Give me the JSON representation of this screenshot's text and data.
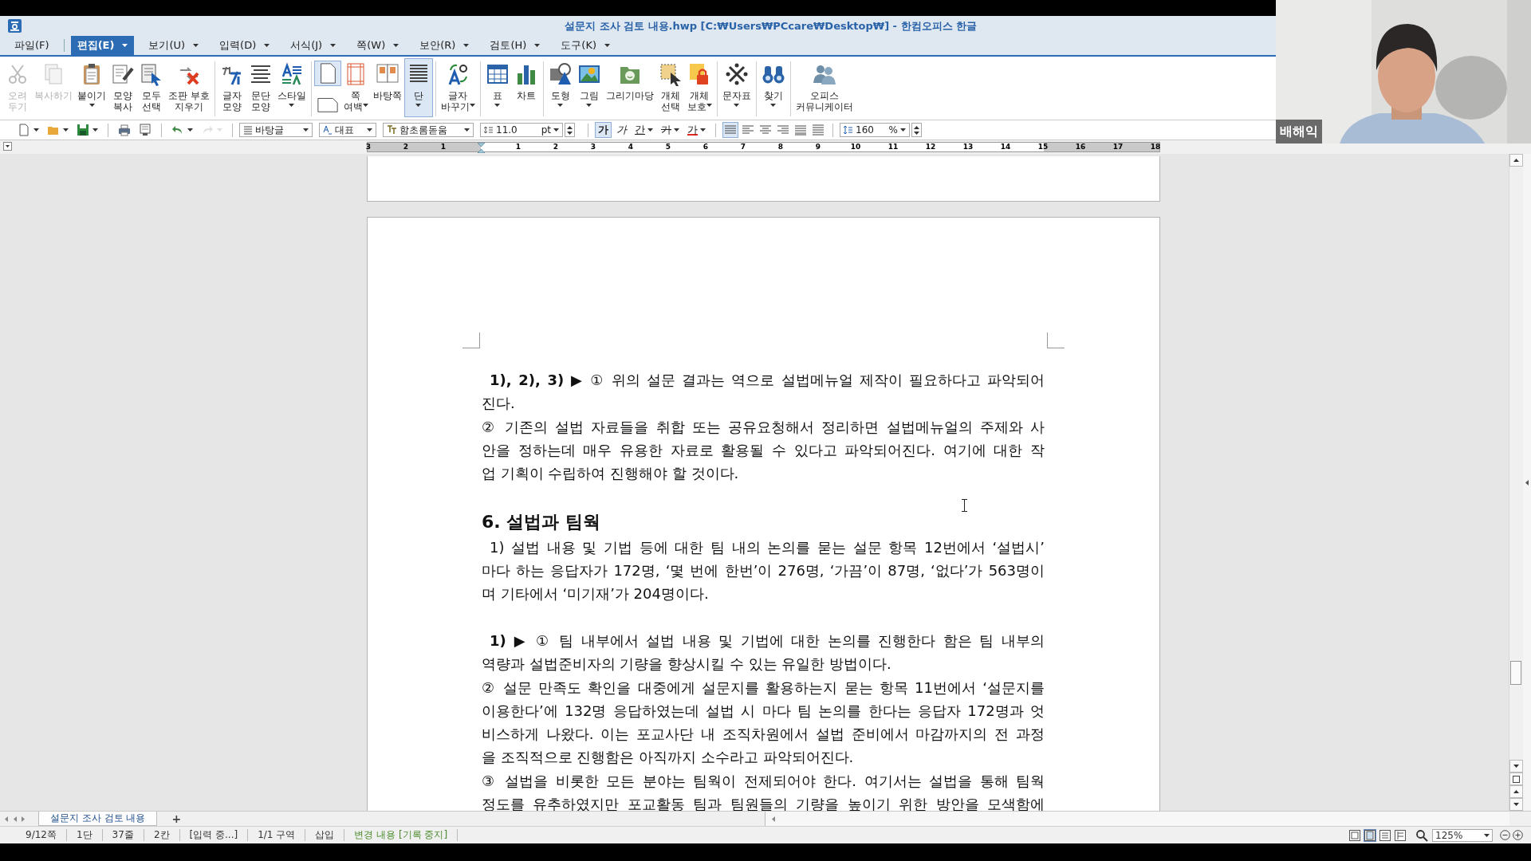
{
  "window": {
    "title": "설문지 조사 검토 내용.hwp [C:₩Users₩PCcare₩Desktop₩] - 한컴오피스 한글"
  },
  "menu": [
    {
      "label": "파일(F)",
      "selected": false,
      "dropdown": false
    },
    {
      "label": "편집(E)",
      "selected": true,
      "dropdown": true
    },
    {
      "label": "보기(U)",
      "selected": false,
      "dropdown": true
    },
    {
      "label": "입력(D)",
      "selected": false,
      "dropdown": true
    },
    {
      "label": "서식(J)",
      "selected": false,
      "dropdown": true
    },
    {
      "label": "쪽(W)",
      "selected": false,
      "dropdown": true
    },
    {
      "label": "보안(R)",
      "selected": false,
      "dropdown": true
    },
    {
      "label": "검토(H)",
      "selected": false,
      "dropdown": true
    },
    {
      "label": "도구(K)",
      "selected": false,
      "dropdown": true
    }
  ],
  "toolbar": [
    {
      "kind": "button",
      "label": "오려\n두기",
      "disabled": true,
      "pressed": false
    },
    {
      "kind": "button",
      "label": "복사하기",
      "disabled": true,
      "pressed": false
    },
    {
      "kind": "button",
      "label": "붙이기",
      "disabled": false,
      "pressed": false,
      "dropdown": true,
      "inline_caret": false
    },
    {
      "kind": "button",
      "label": "모양\n복사",
      "disabled": false,
      "pressed": false
    },
    {
      "kind": "button",
      "label": "모두\n선택",
      "disabled": false,
      "pressed": false
    },
    {
      "kind": "button",
      "label": "조판 부호\n지우기",
      "disabled": false,
      "pressed": false
    },
    {
      "kind": "separator"
    },
    {
      "kind": "button",
      "label": "글자\n모양",
      "disabled": false,
      "pressed": false
    },
    {
      "kind": "button",
      "label": "문단\n모양",
      "disabled": false,
      "pressed": false
    },
    {
      "kind": "button",
      "label": "스타일",
      "disabled": false,
      "pressed": false,
      "dropdown": true,
      "inline_caret": false
    },
    {
      "kind": "separator"
    },
    {
      "kind": "stack",
      "items": [
        {
          "pressed": true
        },
        {
          "pressed": false
        }
      ]
    },
    {
      "kind": "button",
      "label": "쪽\n여백",
      "disabled": false,
      "pressed": false,
      "dropdown": true,
      "inline_caret": true
    },
    {
      "kind": "button",
      "label": "바탕쪽",
      "disabled": false,
      "pressed": false
    },
    {
      "kind": "button",
      "label": "단",
      "disabled": false,
      "pressed": true,
      "dropdown": true,
      "inline_caret": false
    },
    {
      "kind": "separator"
    },
    {
      "kind": "button",
      "label": "글자\n바꾸기",
      "disabled": false,
      "pressed": false,
      "dropdown": true,
      "inline_caret": true
    },
    {
      "kind": "separator"
    },
    {
      "kind": "button",
      "label": "표",
      "disabled": false,
      "pressed": false,
      "dropdown": true,
      "inline_caret": false
    },
    {
      "kind": "button",
      "label": "차트",
      "disabled": false,
      "pressed": false
    },
    {
      "kind": "separator"
    },
    {
      "kind": "button",
      "label": "도형",
      "disabled": false,
      "pressed": false,
      "dropdown": true,
      "inline_caret": false
    },
    {
      "kind": "button",
      "label": "그림",
      "disabled": false,
      "pressed": false,
      "dropdown": true,
      "inline_caret": false
    },
    {
      "kind": "button",
      "label": "그리기마당",
      "disabled": false,
      "pressed": false
    },
    {
      "kind": "button",
      "label": "개체\n선택",
      "disabled": false,
      "pressed": false
    },
    {
      "kind": "button",
      "label": "개체\n보호",
      "disabled": false,
      "pressed": false,
      "dropdown": true,
      "inline_caret": true
    },
    {
      "kind": "separator"
    },
    {
      "kind": "button",
      "label": "문자표",
      "disabled": false,
      "pressed": false,
      "dropdown": true,
      "inline_caret": false
    },
    {
      "kind": "separator"
    },
    {
      "kind": "button",
      "label": "찾기",
      "disabled": false,
      "pressed": false,
      "dropdown": true,
      "inline_caret": false
    },
    {
      "kind": "separator"
    },
    {
      "kind": "button",
      "label": "오피스\n커뮤니케이터",
      "disabled": false,
      "pressed": false
    }
  ],
  "format_bar": {
    "tools": [
      {
        "kind": "new",
        "dropdown": true,
        "disabled": false
      },
      {
        "kind": "open",
        "dropdown": true,
        "disabled": false
      },
      {
        "kind": "save",
        "dropdown": true,
        "disabled": false
      },
      {
        "kind": "separator"
      },
      {
        "kind": "print",
        "dropdown": false,
        "disabled": false
      },
      {
        "kind": "preview",
        "dropdown": false,
        "disabled": false
      },
      {
        "kind": "separator"
      },
      {
        "kind": "undo",
        "dropdown": true,
        "disabled": false
      },
      {
        "kind": "redo",
        "dropdown": true,
        "disabled": true
      }
    ],
    "style": "바탕글",
    "language": "대표",
    "font": "함초롬돋움",
    "size": "11.0",
    "size_unit": "pt",
    "char_buttons": [
      {
        "kind": "bold",
        "label": "가",
        "pressed": true,
        "dropdown": false
      },
      {
        "kind": "italic",
        "label": "가",
        "pressed": false,
        "dropdown": false
      },
      {
        "kind": "underline",
        "label": "간",
        "pressed": false,
        "dropdown": true
      },
      {
        "kind": "strike",
        "label": "가",
        "pressed": false,
        "dropdown": true
      },
      {
        "kind": "color",
        "label": "가",
        "pressed": false,
        "dropdown": true
      }
    ],
    "align": [
      {
        "kind": "justify",
        "pressed": true
      },
      {
        "kind": "left",
        "pressed": false
      },
      {
        "kind": "center",
        "pressed": false
      },
      {
        "kind": "right",
        "pressed": false
      },
      {
        "kind": "distribute",
        "pressed": false
      },
      {
        "kind": "divide",
        "pressed": false
      }
    ],
    "line_spacing": "160",
    "line_spacing_unit": "%"
  },
  "ruler": {
    "left_numbers": [
      "3",
      "2",
      "1"
    ],
    "right_numbers": [
      "1",
      "2",
      "3",
      "4",
      "5",
      "6",
      "7",
      "8",
      "9",
      "10",
      "11",
      "12",
      "13",
      "14",
      "15",
      "16",
      "17",
      "18"
    ]
  },
  "document": {
    "paragraphs": [
      {
        "kind": "body",
        "indent": true,
        "continues": false,
        "lines": [
          "**1), 2), 3) ▶** ① 위의 설문 결과는 역으로 설법메뉴얼 제작이 필요하다고 파악되어",
          "진다."
        ]
      },
      {
        "kind": "body",
        "indent": false,
        "continues": false,
        "lines": [
          "② 기존의 설법 자료들을 취합 또는 공유요청해서 정리하면 설법메뉴얼의 주제와 사",
          "안을 정하는데 매우 유용한 자료로 활용될 수 있다고 파악되어진다. 여기에 대한 작",
          "업 기획이 수립하여 진행해야 할 것이다."
        ]
      },
      {
        "kind": "blank"
      },
      {
        "kind": "heading",
        "lines": [
          "6. 설법과 팀웍"
        ]
      },
      {
        "kind": "body",
        "indent": true,
        "continues": false,
        "lines": [
          "1) 설법 내용 및 기법 등에 대한 팀 내의 논의를 묻는 설문 항목 12번에서 ‘설법시’",
          "마다 하는 응답자가 172명, ‘몇 번에 한번’이 276명, ‘가끔’이 87명, ‘없다’가 563명이",
          "며 기타에서 ‘미기재’가 204명이다."
        ]
      },
      {
        "kind": "blank"
      },
      {
        "kind": "body",
        "indent": true,
        "continues": false,
        "lines": [
          "**1) ▶** ① 팀 내부에서 설법 내용 및 기법에 대한 논의를 진행한다 함은 팀 내부의",
          "역량과 설법준비자의 기량을 향상시킬 수 있는 유일한 방법이다."
        ]
      },
      {
        "kind": "body",
        "indent": false,
        "continues": false,
        "lines": [
          "② 설문 만족도 확인을 대중에게 설문지를 활용하는지 묻는 항목 11번에서 ‘설문지를",
          "이용한다’에 132명 응답하였는데 설법 시 마다 팀 논의를 한다는 응답자 172명과 엇",
          "비스하게 나왔다. 이는 포교사단 내 조직차원에서 설법 준비에서 마감까지의 전 과정",
          "을 조직적으로 진행함은 아직까지 소수라고 파악되어진다."
        ]
      },
      {
        "kind": "body",
        "indent": false,
        "continues": true,
        "lines": [
          "③ 설법을 비롯한 모든 분야는 팀웍이 전제되어야 한다. 여기서는 설법을 통해 팀웍",
          "정도를 유추하였지만 포교활동 팀과 팀원들의 기량을 높이기 위한 방안을 모색함에"
        ]
      }
    ]
  },
  "tabs": [
    {
      "label": "설문지 조사 검토 내용",
      "selected": true
    }
  ],
  "add_tab": "+",
  "status_bar": [
    {
      "kind": "plain",
      "text": "9/12쪽"
    },
    {
      "kind": "plain",
      "text": "1단"
    },
    {
      "kind": "plain",
      "text": "37줄"
    },
    {
      "kind": "plain",
      "text": "2칸"
    },
    {
      "kind": "plain",
      "text": "[입력 중...]"
    },
    {
      "kind": "plain",
      "text": "1/1 구역"
    },
    {
      "kind": "plain",
      "text": "삽입"
    },
    {
      "kind": "tracking",
      "text": "변경 내용 [기록 중지]"
    }
  ],
  "zoom": "125%",
  "video": {
    "kind": "picture",
    "name": "배해익"
  }
}
